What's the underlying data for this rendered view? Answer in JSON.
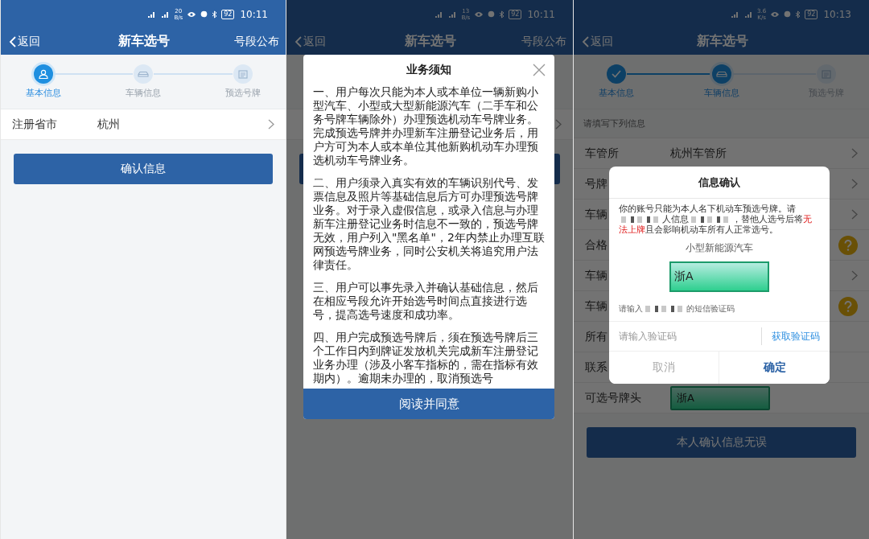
{
  "screens": [
    {
      "status_bar": {
        "speed": "20",
        "speed_unit": "B/s",
        "battery": "92",
        "time": "10:11"
      },
      "header": {
        "back": "返回",
        "title": "新车选号",
        "action": "号段公布"
      },
      "steps": [
        {
          "label": "基本信息",
          "done": false,
          "active": true
        },
        {
          "label": "车辆信息",
          "done": false,
          "active": false
        },
        {
          "label": "预选号牌",
          "done": false,
          "active": false
        }
      ],
      "rows": [
        {
          "label": "注册省市",
          "value": "杭州",
          "chevron": true
        }
      ],
      "button": "确认信息"
    },
    {
      "status_bar": {
        "speed": "13",
        "speed_unit": "B/s",
        "battery": "92",
        "time": "10:11"
      },
      "header": {
        "back": "返回",
        "title": "新车选号",
        "action": "号段公布"
      },
      "rows": [
        {
          "chevron": true
        }
      ],
      "dialog": {
        "kind": "notice",
        "title": "业务须知",
        "paragraphs": [
          "一、用户每次只能为本人或本单位一辆新购小型汽车、小型或大型新能源汽车（二手车和公务号牌车辆除外）办理预选机动车号牌业务。完成预选号牌并办理新车注册登记业务后，用户方可为本人或本单位其他新购机动车办理预选机动车号牌业务。",
          "二、用户须录入真实有效的车辆识别代号、发票信息及照片等基础信息后方可办理预选号牌业务。对于录入虚假信息，或录入信息与办理新车注册登记业务时信息不一致的，预选号牌无效，用户列入\"黑名单\"，2年内禁止办理互联网预选号牌业务，同时公安机关将追究用户法律责任。",
          "三、用户可以事先录入并确认基础信息，然后在相应号段允许开始选号时间点直接进行选号，提高选号速度和成功率。",
          "四、用户完成预选号牌后，须在预选号牌后三个工作日内到牌证发放机关完成新车注册登记业务办理（涉及小客车指标的，需在指标有效期内）。逾期未办理的，取消预选号"
        ],
        "button": "阅读并同意"
      }
    },
    {
      "status_bar": {
        "speed": "3.6",
        "speed_unit": "K/s",
        "battery": "92",
        "time": "10:13"
      },
      "header": {
        "back": "返回",
        "title": "新车选号"
      },
      "steps": [
        {
          "label": "基本信息",
          "done": true,
          "active": false
        },
        {
          "label": "车辆信息",
          "done": false,
          "active": true
        },
        {
          "label": "预选号牌",
          "done": false,
          "active": false
        }
      ],
      "section_hint": "请填写下列信息",
      "rows": [
        {
          "label": "车管所",
          "value": "杭州车管所",
          "chevron": true
        },
        {
          "label": "号牌",
          "chevron": true
        },
        {
          "label": "车辆",
          "chevron": true
        },
        {
          "label": "合格",
          "help": true
        },
        {
          "label": "车辆",
          "chevron": true
        },
        {
          "label": "车辆",
          "help": true
        },
        {
          "label": "所有"
        },
        {
          "label": "联系"
        },
        {
          "label": "可选号牌头",
          "plate": "浙A"
        }
      ],
      "button": "本人确认信息无误",
      "dialog": {
        "kind": "confirm",
        "title": "信息确认",
        "message": [
          {
            "kind": "text",
            "text": "你的账号只能为本人名下机动车预选号牌。请"
          },
          {
            "kind": "redacted"
          },
          {
            "kind": "text",
            "text": "人信息"
          },
          {
            "kind": "redacted"
          },
          {
            "kind": "text",
            "text": "，替他人选号后将"
          },
          {
            "kind": "warning",
            "text": "无法上牌"
          },
          {
            "kind": "text",
            "text": "且会影响机动车所有人正常选号。"
          }
        ],
        "vehicle_type": "小型新能源汽车",
        "plate": "浙A",
        "sms_prompt": [
          {
            "kind": "text",
            "text": "请输入"
          },
          {
            "kind": "redacted"
          },
          {
            "kind": "text",
            "text": "的短信验证码"
          }
        ],
        "code_placeholder": "请输入验证码",
        "get_code": "获取验证码",
        "cancel": "取消",
        "ok": "确定"
      }
    }
  ]
}
